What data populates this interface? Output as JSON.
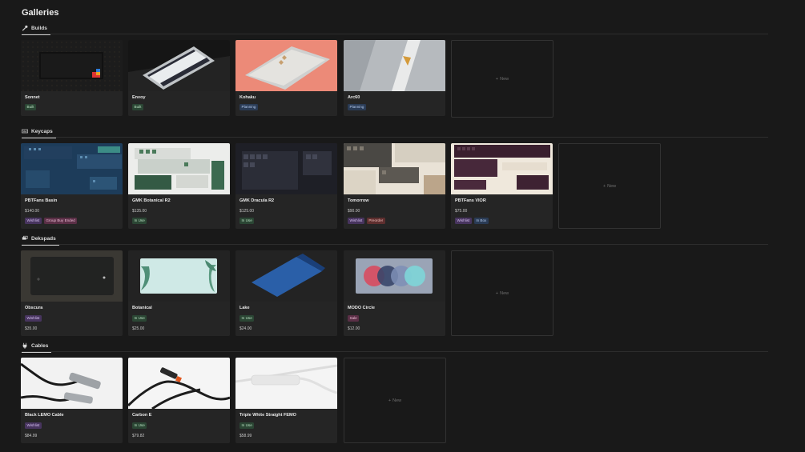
{
  "page_title": "Galleries",
  "sections": {
    "builds": {
      "label": "Builds",
      "icon": "hammer-icon"
    },
    "keycaps": {
      "label": "Keycaps",
      "icon": "keyboard-icon"
    },
    "deskpads": {
      "label": "Dekspads",
      "icon": "layers-icon"
    },
    "cables": {
      "label": "Cables",
      "icon": "plug-icon"
    }
  },
  "new_label": "New",
  "builds": [
    {
      "name": "Sonnet",
      "tags": [
        "Built"
      ]
    },
    {
      "name": "Envoy",
      "tags": [
        "Built"
      ]
    },
    {
      "name": "Kohaku",
      "tags": [
        "Planning"
      ]
    },
    {
      "name": "Arc60",
      "tags": [
        "Planning"
      ]
    }
  ],
  "keycaps": [
    {
      "name": "PBTFans Basin",
      "price": "$140.00",
      "tags": [
        "Wishlist",
        "Group Buy Ended"
      ]
    },
    {
      "name": "GMK Botanical R2",
      "price": "$135.00",
      "tags": [
        "In Use"
      ]
    },
    {
      "name": "GMK Dracula R2",
      "price": "$125.00",
      "tags": [
        "In Use"
      ]
    },
    {
      "name": "Tomorrow",
      "price": "$90.00",
      "tags": [
        "Wishlist",
        "Preorder"
      ]
    },
    {
      "name": "PBTFans VIOR",
      "price": "$75.00",
      "tags": [
        "Wishlist",
        "In Box"
      ]
    }
  ],
  "deskpads": [
    {
      "name": "Obscura",
      "price": "$35.00",
      "tags": [
        "Wishlist"
      ]
    },
    {
      "name": "Botanical",
      "price": "$25.00",
      "tags": [
        "In Use"
      ]
    },
    {
      "name": "Lake",
      "price": "$24.00",
      "tags": [
        "In Use"
      ]
    },
    {
      "name": "MODO Circle",
      "price": "$12.00",
      "tags": [
        "Sale"
      ]
    }
  ],
  "cables": [
    {
      "name": "Black LEMO Cable",
      "price": "$84.99",
      "tags": [
        "Wishlist"
      ]
    },
    {
      "name": "Carbon E",
      "price": "$79.82",
      "tags": [
        "In Use"
      ]
    },
    {
      "name": "Triple White Straight FEMO",
      "price": "$58.99",
      "tags": [
        "In Use"
      ]
    }
  ],
  "colors": {
    "background": "#191919",
    "card": "#252525",
    "tag_built": "#2b4634",
    "tag_planning": "#2a3b55",
    "tag_wishlist": "#47345e",
    "tag_group_buy_ended": "#5a2f46",
    "tag_preorder": "#5e2f2f",
    "tag_sale": "#5a2f46"
  }
}
